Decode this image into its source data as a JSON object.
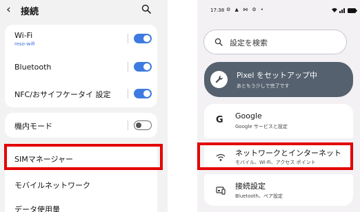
{
  "left": {
    "header": {
      "back_icon": "‹",
      "title": "接続",
      "search_icon": "search-icon"
    },
    "wifi": {
      "label": "Wi-Fi",
      "network": "reso-wifi",
      "enabled": true
    },
    "bluetooth": {
      "label": "Bluetooth",
      "enabled": true
    },
    "nfc": {
      "label": "NFC/おサイフケータイ 設定",
      "enabled": true
    },
    "airplane": {
      "label": "機内モード",
      "enabled": false
    },
    "sim_manager": {
      "label": "SIMマネージャー"
    },
    "mobile_network": {
      "label": "モバイルネットワーク"
    },
    "data_usage": {
      "label": "データ使用量"
    },
    "colors": {
      "toggle_on": "#3e7be0",
      "highlight": "#e30000"
    }
  },
  "right": {
    "status_bar": {
      "time": "17:38",
      "icons": "⚙ ▲ ⋈ ⚙ •"
    },
    "search": {
      "placeholder": "設定を検索",
      "icon": "search-icon"
    },
    "setup_card": {
      "title": "Pixel をセットアップ中",
      "subtitle": "あともう少しで完了です",
      "icon": "wrench-icon"
    },
    "google": {
      "title": "Google",
      "subtitle": "Google サービスと設定",
      "icon": "google-icon"
    },
    "network": {
      "title": "ネットワークとインターネット",
      "subtitle": "モバイル、Wi-Fi、アクセス ポイント",
      "icon": "wifi-icon"
    },
    "connected": {
      "title": "接続設定",
      "subtitle": "Bluetooth、ペア設定",
      "icon": "devices-icon"
    }
  }
}
